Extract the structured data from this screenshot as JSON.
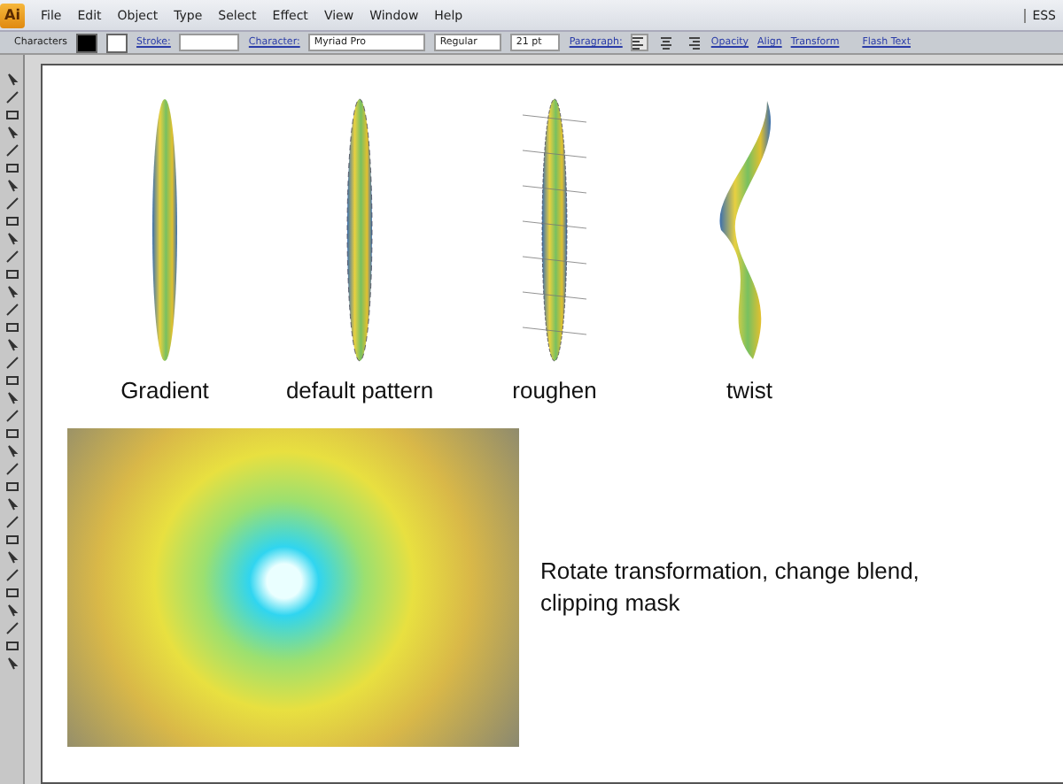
{
  "app": {
    "logo": "Ai",
    "menu": [
      "File",
      "Edit",
      "Object",
      "Type",
      "Select",
      "Effect",
      "View",
      "Window",
      "Help"
    ],
    "workspace": "ESS"
  },
  "control_bar": {
    "panel_label": "Characters",
    "stroke_link": "Stroke:",
    "character_link": "Character:",
    "font": "Myriad Pro",
    "style": "Regular",
    "size": "21 pt",
    "paragraph_link": "Paragraph:",
    "align_options": [
      {
        "kind": "left",
        "selected": true
      },
      {
        "kind": "center",
        "selected": false
      },
      {
        "kind": "right",
        "selected": false
      }
    ],
    "links": [
      "Opacity",
      "Align",
      "Transform"
    ],
    "flash_link": "Flash Text"
  },
  "artboard": {
    "samples": [
      {
        "kind": "plain",
        "label": "Gradient"
      },
      {
        "kind": "pattern",
        "label": "default pattern"
      },
      {
        "kind": "rough",
        "label": "roughen"
      },
      {
        "kind": "twist",
        "label": "twist"
      }
    ],
    "caption": "Rotate transformation, change blend, clipping mask"
  }
}
